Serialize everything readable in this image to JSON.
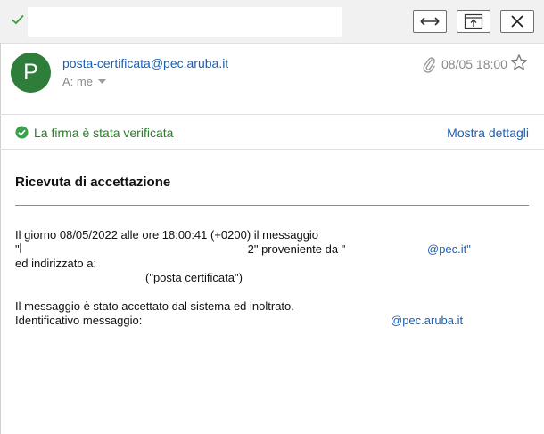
{
  "topbar": {
    "subject_text": "",
    "buttons": [
      {
        "name": "expand",
        "icon": "double-arrow-icon"
      },
      {
        "name": "popout",
        "icon": "popout-window-icon"
      },
      {
        "name": "close",
        "icon": "close-icon"
      }
    ]
  },
  "message": {
    "avatar_letter": "P",
    "sender": "posta-certificata@pec.aruba.it",
    "recipient_label": "A: me",
    "date": "08/05 18:00",
    "attachment_icon": "paperclip-icon",
    "star_icon": "star-icon"
  },
  "signature": {
    "status_text": "La firma è stata verificata",
    "details_link": "Mostra dettagli",
    "color": "#2d7a2d"
  },
  "body": {
    "title": "Ricevuta di accettazione",
    "line1": "Il giorno 08/05/2022 alle ore 18:00:41 (+0200) il messaggio",
    "line2_start": "\"",
    "line2_mid": "2\" proveniente da \"",
    "line2_end": "@pec.it\"",
    "line3": "ed indirizzato a:",
    "line4": "(\"posta certificata\")",
    "line5": "Il messaggio è stato accettato dal sistema ed inoltrato.",
    "line6": "Identificativo messaggio:",
    "line6_end": "@pec.aruba.it"
  },
  "colors": {
    "link": "#1a5fb4",
    "avatar": "#2f7d3a",
    "topbar": "#f1f1f1"
  }
}
